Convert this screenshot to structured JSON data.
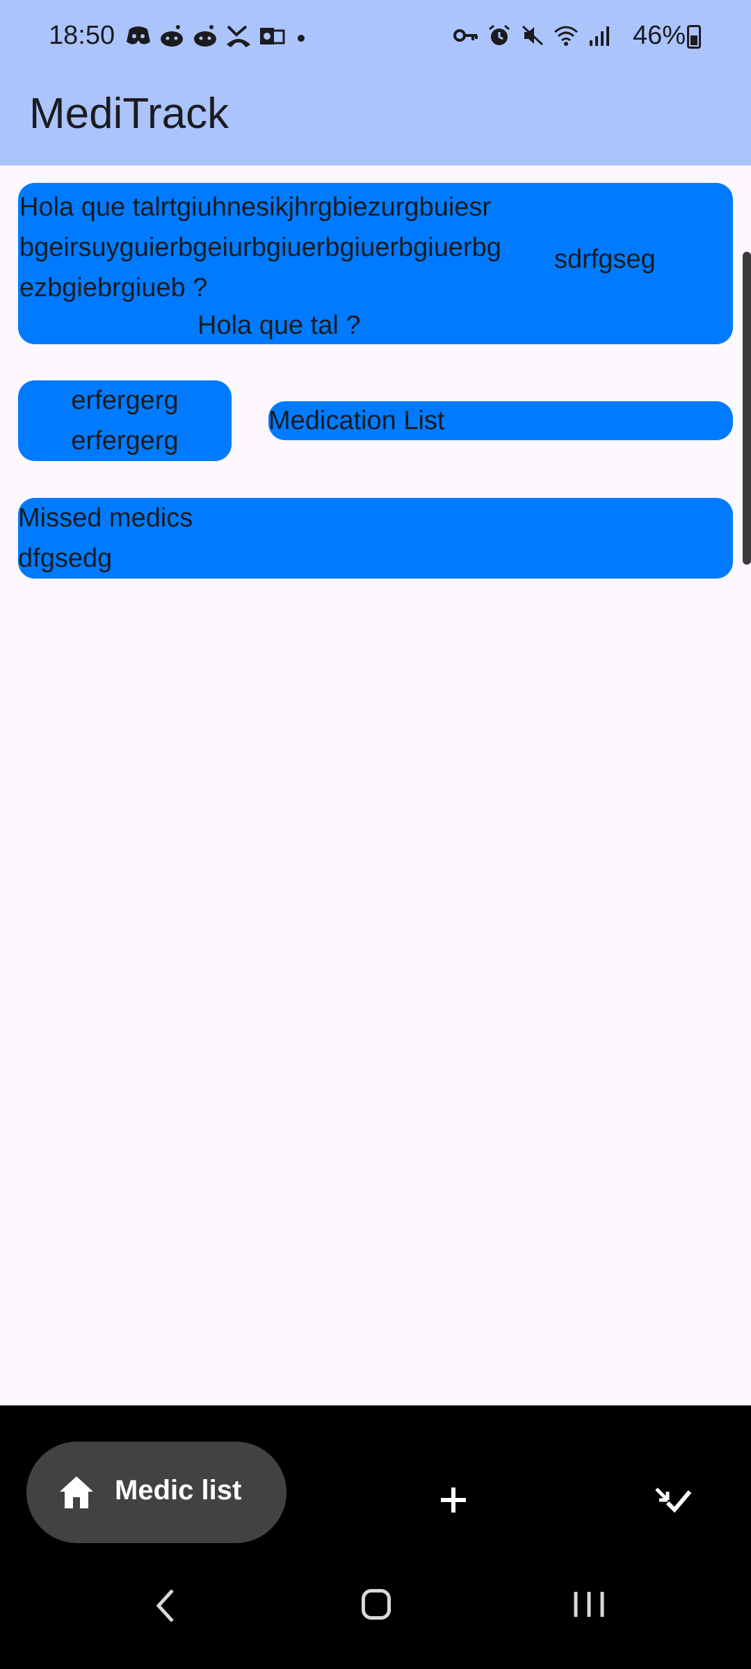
{
  "status_bar": {
    "time": "18:50",
    "battery": "46%",
    "notification_icons": [
      "discord-icon",
      "reddit-icon",
      "reddit-icon",
      "missed-call-icon",
      "outlook-icon"
    ],
    "system_icons": [
      "vpn-key-icon",
      "alarm-icon",
      "mute-icon",
      "wifi-icon",
      "signal-icon",
      "battery-icon"
    ]
  },
  "app_bar": {
    "title": "MediTrack"
  },
  "cards": {
    "card1": {
      "left_text": "Hola que talrtgiuhnesikjhrgbiezurgbuiesr bgeirsuyguierbgeiurbgiuerbgiuerbgiuerbg ezbgiebrgiueb ?",
      "right_text": "sdrfgseg",
      "center_text": "Hola que tal ?"
    },
    "card2": {
      "line1": "erfergerg",
      "line2": "erfergerg"
    },
    "card3": {
      "text": "Medication List"
    },
    "card4": {
      "line1": "Missed medics",
      "line2": "dfgsedg"
    }
  },
  "bottom_nav": {
    "selected_label": "Medic list",
    "items": [
      "home-icon",
      "add-icon",
      "checklist-icon"
    ]
  },
  "colors": {
    "app_bar": "#abc4fc",
    "card": "#007bff",
    "background": "#fcf8fd",
    "nav_bg": "#000000",
    "nav_pill": "#424242"
  }
}
